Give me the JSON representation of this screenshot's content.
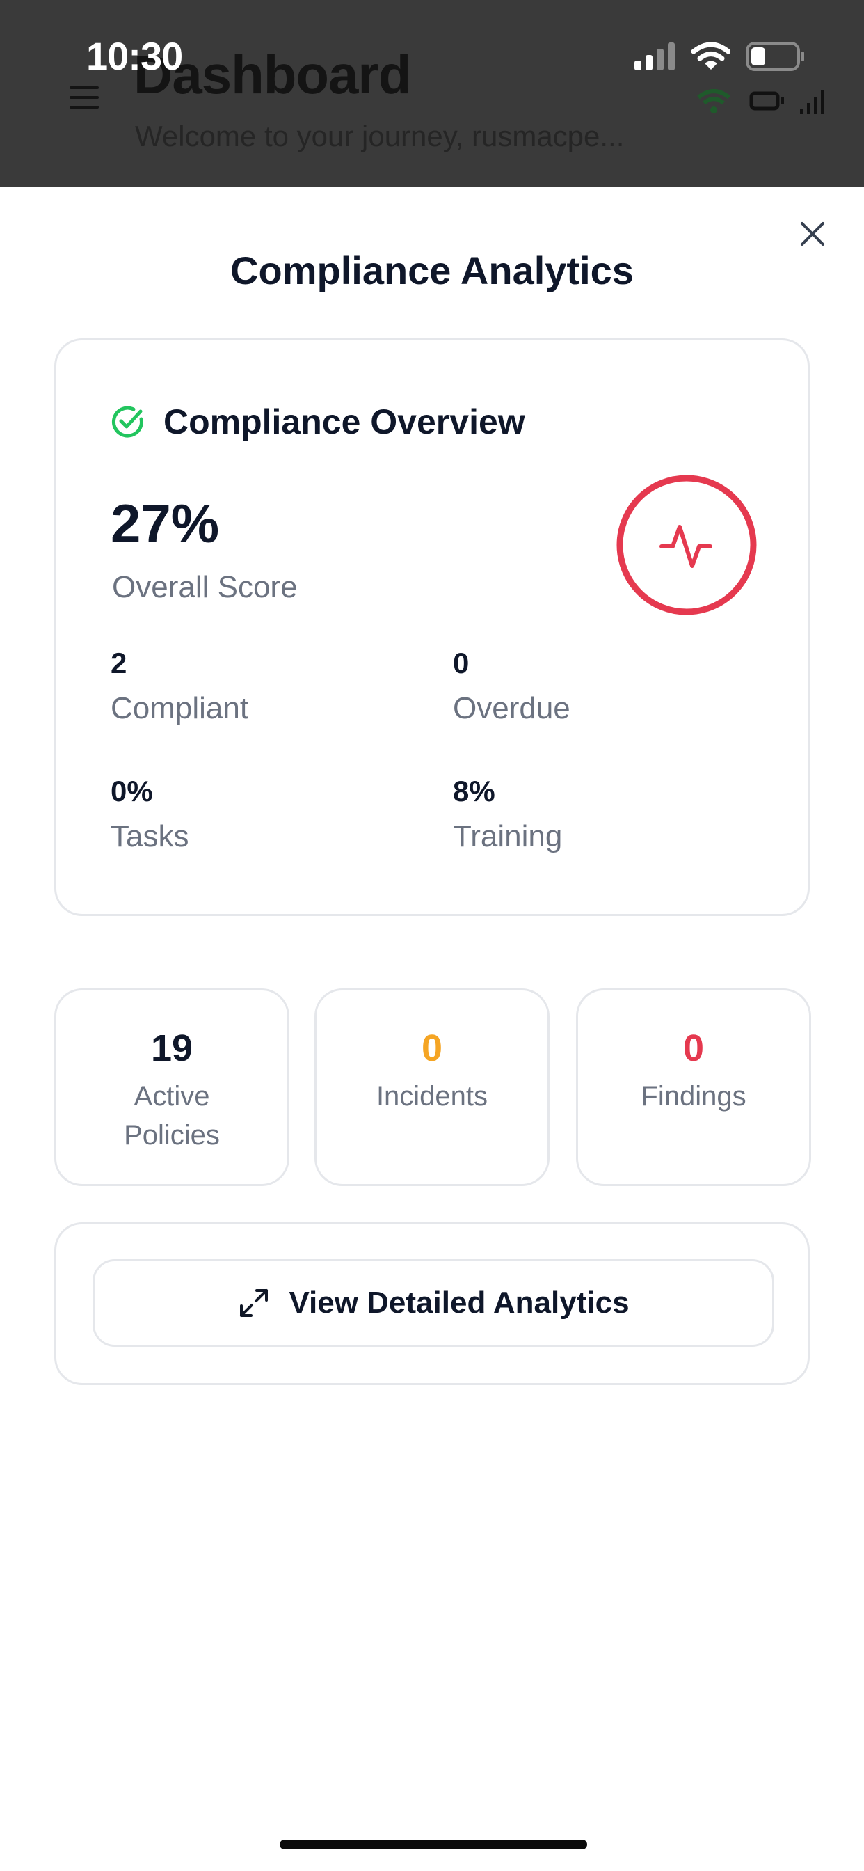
{
  "status_bar": {
    "time": "10:30"
  },
  "background_app": {
    "title": "Dashboard",
    "subtitle": "Welcome to your journey, rusmacpe..."
  },
  "sheet": {
    "title": "Compliance Analytics",
    "close_icon": "close-icon"
  },
  "overview": {
    "icon": "check-circle-icon",
    "title": "Compliance Overview",
    "score": "27%",
    "score_label": "Overall Score",
    "status_icon": "activity-icon",
    "stats": [
      {
        "value": "2",
        "label": "Compliant"
      },
      {
        "value": "0",
        "label": "Overdue"
      },
      {
        "value": "0%",
        "label": "Tasks"
      },
      {
        "value": "8%",
        "label": "Training"
      }
    ]
  },
  "summary": [
    {
      "value": "19",
      "label_line1": "Active",
      "label_line2": "Policies",
      "color": "#0f172a"
    },
    {
      "value": "0",
      "label_line1": "Incidents",
      "label_line2": "",
      "color": "#f5a524"
    },
    {
      "value": "0",
      "label_line1": "Findings",
      "label_line2": "",
      "color": "#e5394f"
    }
  ],
  "actions": {
    "detailed_label": "View Detailed Analytics",
    "detailed_icon": "expand-icon"
  },
  "colors": {
    "accent_green": "#22c55e",
    "alert_red": "#e5394f",
    "warning_amber": "#f5a524"
  }
}
